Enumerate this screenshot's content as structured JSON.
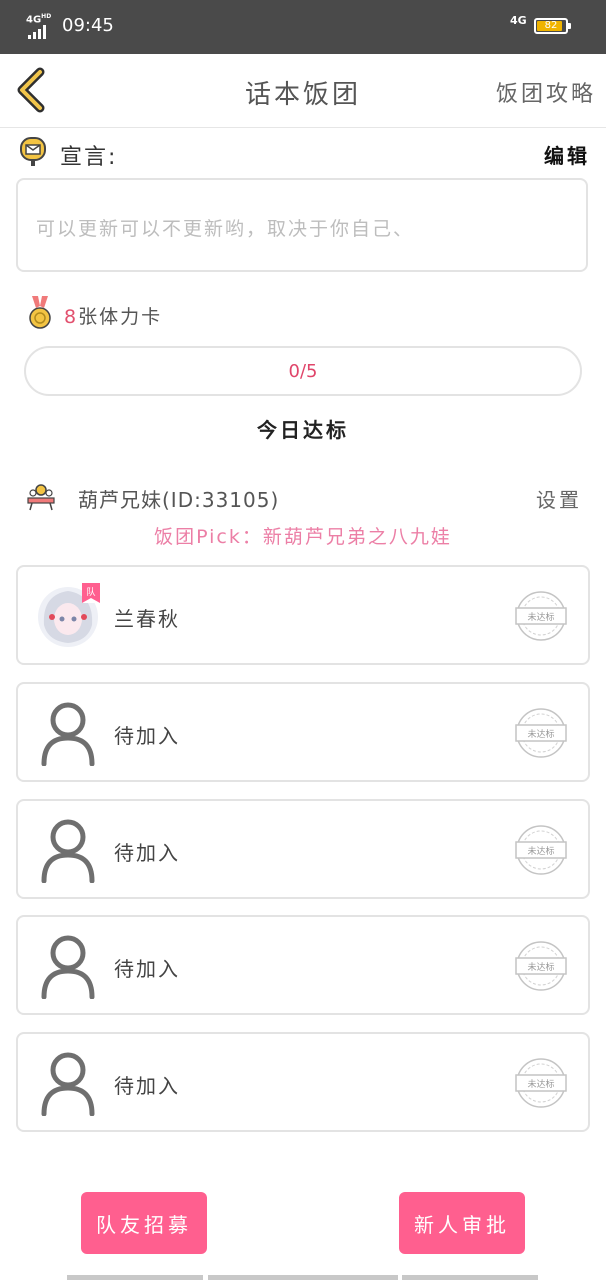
{
  "status_bar": {
    "network_left": "4G",
    "network_left_sup": "HD",
    "time": "09:45",
    "network_right": "4G",
    "battery": "82",
    "battery_level": 0.82
  },
  "nav": {
    "title": "话本饭团",
    "right_link": "饭团攻略",
    "back_icon": "chevron-left-icon"
  },
  "declaration": {
    "label": "宣言:",
    "edit": "编辑",
    "text": "可以更新可以不更新哟，取决于你自己、"
  },
  "stamina": {
    "count": "8",
    "suffix": "张体力卡"
  },
  "progress": {
    "text": "0/5",
    "value": 0,
    "max": 5,
    "caption": "今日达标"
  },
  "group": {
    "name": "葫芦兄妹(ID:33105)",
    "settings": "设置",
    "pick": "饭团Pick：新葫芦兄弟之八九娃"
  },
  "members": [
    {
      "name": "兰春秋",
      "badge": "队",
      "stamp": "未达标",
      "avatar": "anime-girl-avatar"
    },
    {
      "name": "待加入",
      "stamp": "未达标",
      "avatar": "person-placeholder-icon"
    },
    {
      "name": "待加入",
      "stamp": "未达标",
      "avatar": "person-placeholder-icon"
    },
    {
      "name": "待加入",
      "stamp": "未达标",
      "avatar": "person-placeholder-icon"
    },
    {
      "name": "待加入",
      "stamp": "未达标",
      "avatar": "person-placeholder-icon"
    }
  ],
  "buttons": {
    "recruit": "队友招募",
    "approve": "新人审批"
  },
  "colors": {
    "accent": "#ff5f8f",
    "pick": "#ec7fa6",
    "status_bar": "#4a4a4a"
  }
}
